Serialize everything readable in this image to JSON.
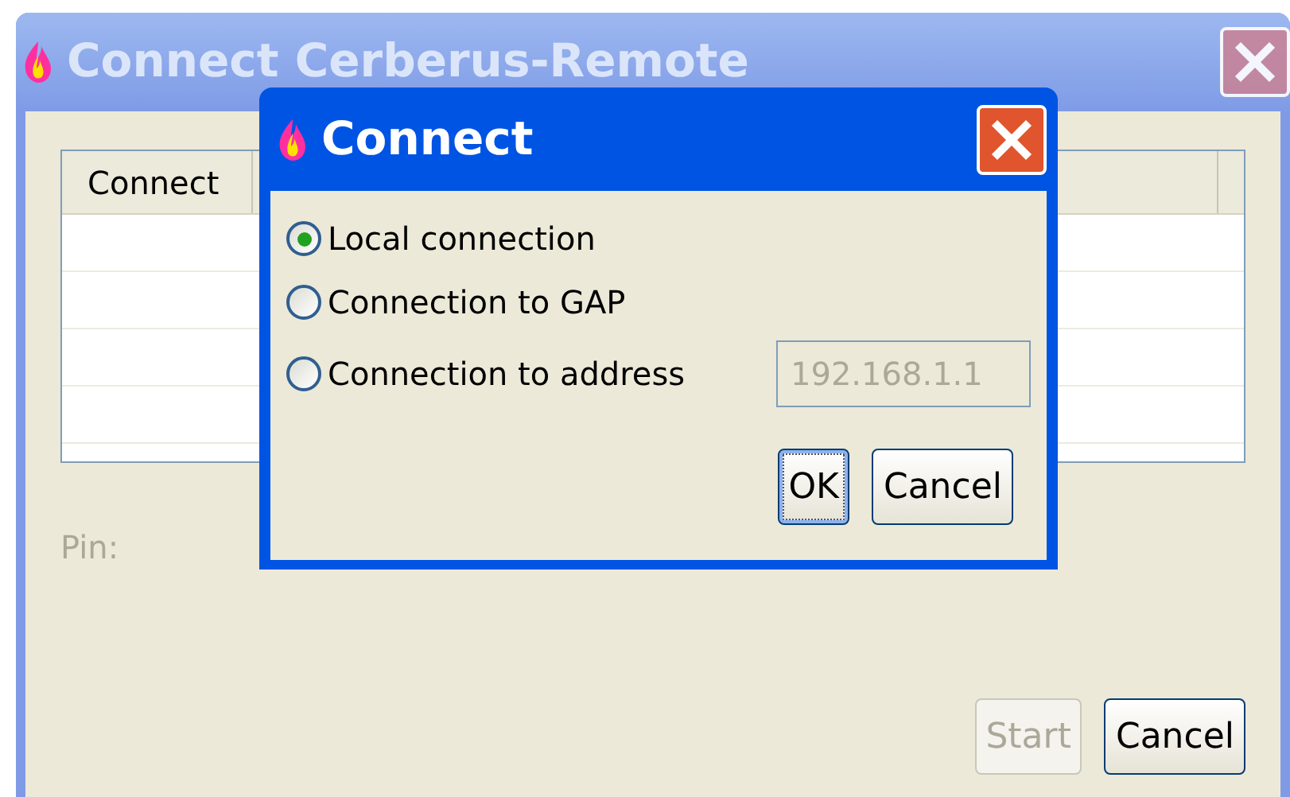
{
  "window": {
    "title": "Connect Cerberus-Remote",
    "active": false
  },
  "table": {
    "columns": [
      "Connect"
    ]
  },
  "pin": {
    "label": "Pin:",
    "disabled": true
  },
  "buttons": [
    {
      "label": "Start",
      "disabled": true
    },
    {
      "label": "Cancel",
      "disabled": false
    }
  ],
  "dialog": {
    "title": "Connect",
    "active": true,
    "options": [
      {
        "label": "Local connection",
        "selected": true
      },
      {
        "label": "Connection to GAP",
        "selected": false
      },
      {
        "label": "Connection to address",
        "selected": false
      }
    ],
    "address_field": {
      "value": "192.168.1.1",
      "disabled": true
    },
    "buttons": [
      {
        "label": "OK",
        "focused": true
      },
      {
        "label": "Cancel",
        "focused": false
      }
    ]
  }
}
